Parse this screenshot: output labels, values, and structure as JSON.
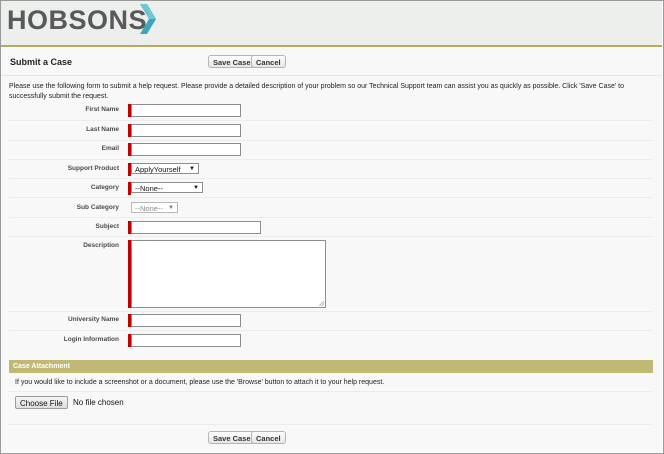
{
  "brand": {
    "logo_text": "HOBSONS",
    "accent": "#b6aa63",
    "required_color": "#c00000"
  },
  "page": {
    "title": "Submit a Case"
  },
  "buttons": {
    "save": "Save Case",
    "cancel": "Cancel"
  },
  "intro": "Please use the following form to submit a help request. Please provide a detailed description of your problem so our Technical Support team can assist you as quickly as possible. Click 'Save Case' to successfully submit the request.",
  "fields": {
    "first_name": {
      "label": "First Name",
      "value": ""
    },
    "last_name": {
      "label": "Last Name",
      "value": ""
    },
    "email": {
      "label": "Email",
      "value": ""
    },
    "support_product": {
      "label": "Support Product",
      "value": "ApplyYourself"
    },
    "category": {
      "label": "Category",
      "value": "--None--"
    },
    "sub_category": {
      "label": "Sub Category",
      "value": "--None--"
    },
    "subject": {
      "label": "Subject",
      "value": ""
    },
    "description": {
      "label": "Description",
      "value": ""
    },
    "university_name": {
      "label": "University Name",
      "value": ""
    },
    "login_information": {
      "label": "Login Information",
      "value": ""
    }
  },
  "attachment": {
    "section_title": "Case Attachment",
    "instructions": "If you would like to include a screenshot or a document, please use the 'Browse' button to attach it to your help request.",
    "choose_button": "Choose File",
    "file_status": "No file chosen"
  },
  "icons": {
    "logo_mark": "chevron-arrow-icon",
    "dropdown": "triangle-down-icon"
  }
}
